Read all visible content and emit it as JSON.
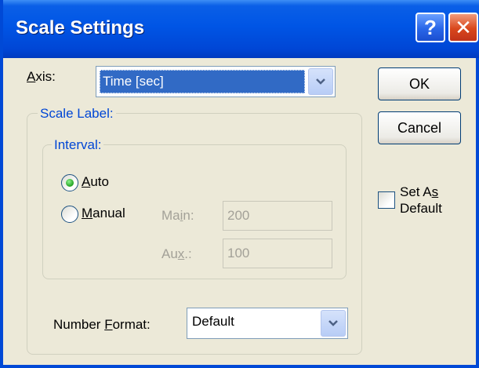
{
  "window": {
    "title": "Scale Settings"
  },
  "titlebar_icons": {
    "help": "?-icon",
    "close": "close-icon"
  },
  "axis": {
    "label_prefix": "",
    "label_access": "A",
    "label_rest": "xis:",
    "value": "Time [sec]"
  },
  "buttons": {
    "ok": "OK",
    "cancel": "Cancel"
  },
  "set_default": {
    "line1_pre": "Set A",
    "line1_access": "s",
    "line2": "Default",
    "checked": false
  },
  "scale_label": {
    "title": "Scale Label:"
  },
  "interval": {
    "title": "Interval:",
    "auto": {
      "pre": "",
      "access": "A",
      "rest": "uto",
      "selected": true
    },
    "manual": {
      "pre": "",
      "access": "M",
      "rest": "anual",
      "selected": false
    },
    "main": {
      "label_pre": "Ma",
      "label_access": "i",
      "label_rest": "n:",
      "value": "200"
    },
    "aux": {
      "label_pre": "Au",
      "label_access": "x",
      "label_rest": ".:",
      "value": "100"
    }
  },
  "number_format": {
    "label_pre": "Number ",
    "label_access": "F",
    "label_rest": "ormat:",
    "value": "Default"
  },
  "colors": {
    "title_bar": "#0055e5",
    "face": "#ece9d8",
    "group_label": "#0046d5",
    "selection": "#316ac5"
  }
}
